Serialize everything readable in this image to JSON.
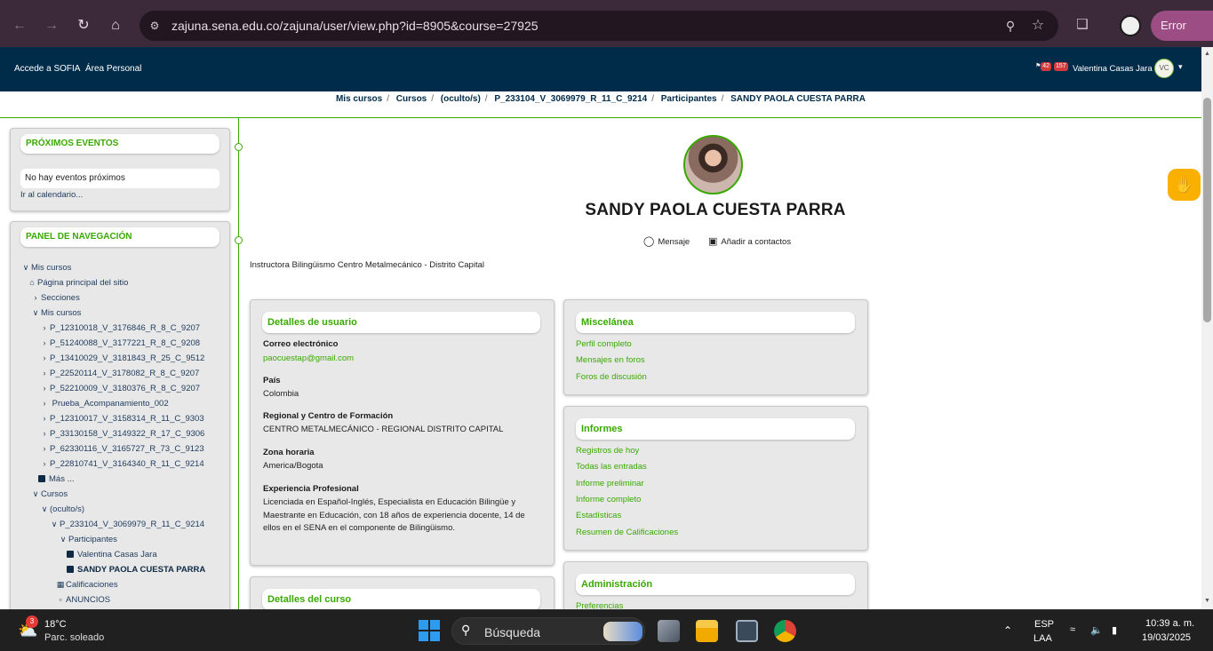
{
  "browser": {
    "url": "zajuna.sena.edu.co/zajuna/user/view.php?id=8905&course=27925",
    "error_label": "Error"
  },
  "header": {
    "link_sofia": "Accede a SOFIA",
    "link_area": "Área Personal",
    "notif_count": "42",
    "msg_count": "157",
    "user_name": "Valentina Casas Jara",
    "user_initials": "VC"
  },
  "breadcrumb": [
    "Mis cursos",
    "Cursos",
    "(oculto/s)",
    "P_233104_V_3069979_R_11_C_9214",
    "Participantes",
    "SANDY PAOLA CUESTA PARRA"
  ],
  "events": {
    "title": "PRÓXIMOS EVENTOS",
    "empty": "No hay eventos próximos",
    "calendar_link": "Ir al calendario..."
  },
  "nav": {
    "title": "PANEL DE NAVEGACIÓN",
    "items": [
      {
        "label": "Mis cursos"
      },
      {
        "label": "Página principal del sitio"
      },
      {
        "label": "Secciones"
      },
      {
        "label": "Mis cursos"
      },
      {
        "label": "P_12310018_V_3176846_R_8_C_9207"
      },
      {
        "label": "P_51240088_V_3177221_R_8_C_9208"
      },
      {
        "label": "P_13410029_V_3181843_R_25_C_9512"
      },
      {
        "label": "P_22520114_V_3178082_R_8_C_9207"
      },
      {
        "label": "P_52210009_V_3180376_R_8_C_9207"
      },
      {
        "label": "Prueba_Acompanamiento_002"
      },
      {
        "label": "P_12310017_V_3158314_R_11_C_9303"
      },
      {
        "label": "P_33130158_V_3149322_R_17_C_9306"
      },
      {
        "label": "P_62330116_V_3165727_R_73_C_9123"
      },
      {
        "label": "P_22810741_V_3164340_R_11_C_9214"
      },
      {
        "label": "Más ..."
      },
      {
        "label": "Cursos"
      },
      {
        "label": "(oculto/s)"
      },
      {
        "label": "P_233104_V_3069979_R_11_C_9214"
      },
      {
        "label": "Participantes"
      },
      {
        "label": "Valentina Casas Jara"
      },
      {
        "label": "SANDY PAOLA CUESTA PARRA"
      },
      {
        "label": "Calificaciones"
      },
      {
        "label": "ANUNCIOS"
      }
    ]
  },
  "profile": {
    "name": "SANDY PAOLA CUESTA PARRA",
    "message_label": "Mensaje",
    "add_contact_label": "Añadir a contactos",
    "description": "Instructora Bilingüismo Centro Metalmecánico - Distrito Capital"
  },
  "user_details": {
    "title": "Detalles de usuario",
    "email_label": "Correo electrónico",
    "email": "paocuestap@gmail.com",
    "country_label": "País",
    "country": "Colombia",
    "regional_label": "Regional y Centro de Formación",
    "regional": "CENTRO METALMECÁNICO - REGIONAL DISTRITO CAPITAL",
    "tz_label": "Zona horaria",
    "tz": "America/Bogota",
    "exp_label": "Experiencia Profesional",
    "exp": "Licenciada en Español-Inglés, Especialista en Educación Bilingüe y Maestrante en Educación, con 18 años de experiencia docente, 14 de ellos en el SENA en el componente de Bilingüismo."
  },
  "course_details": {
    "title": "Detalles del curso"
  },
  "misc": {
    "title": "Miscelánea",
    "links": [
      "Perfil completo",
      "Mensajes en foros",
      "Foros de discusión"
    ]
  },
  "reports": {
    "title": "Informes",
    "links": [
      "Registros de hoy",
      "Todas las entradas",
      "Informe preliminar",
      "Informe completo",
      "Estadísticas",
      "Resumen de Calificaciones"
    ]
  },
  "admin": {
    "title": "Administración",
    "links": [
      "Preferencias"
    ]
  },
  "taskbar": {
    "weather_badge": "3",
    "temp": "18°C",
    "condition": "Parc. soleado",
    "search_placeholder": "Búsqueda",
    "lang1": "ESP",
    "lang2": "LAA",
    "time": "10:39 a. m.",
    "date": "19/03/2025"
  },
  "colors": {
    "accent": "#39a900",
    "header": "#002c4a",
    "help": "#f9b000"
  }
}
